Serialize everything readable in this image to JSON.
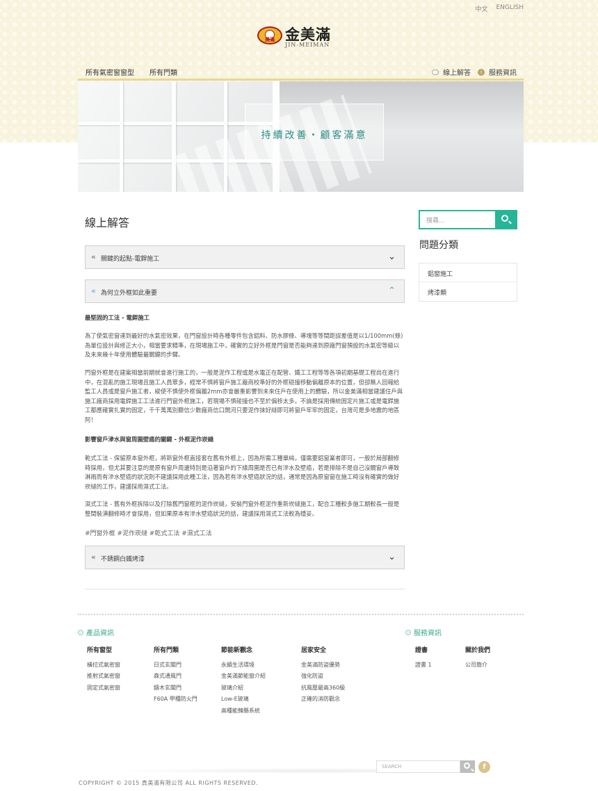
{
  "lang": {
    "zh": "中文",
    "en": "ENGLISH"
  },
  "logo": {
    "cn": "金美滿",
    "en": "JIN-MEIMAN",
    "badge": "美滿"
  },
  "nav": {
    "left": [
      "所有氣密窗窗型",
      "所有門類"
    ],
    "faq": "線上解答",
    "service": "服務資訊"
  },
  "hero": {
    "slogan": "持續改善・顧客滿意"
  },
  "main": {
    "title": "線上解答",
    "accordion": [
      {
        "label": "關鍵的起點-電銲施工",
        "open": false
      },
      {
        "label": "為何立外框如此重要",
        "open": true
      },
      {
        "label": "不銹鋼白鐵烤漆",
        "open": false
      }
    ],
    "article": {
      "h1": "最堅固的工法 - 電銲施工",
      "p1": "為了使氣密窗達到最好的水氣密效果，在門窗設計時各種零件包含鋁料、防水膠條、導塊等等間距誤差值是以1/100mm(條)為單位設計與修正大小，相當要求精準，在現場施工中，確實的立好外框是門窗是否能夠達到原廠門窗預設的水氣密等級以及未來幾十年使用體驗最關鍵的步驟。",
      "p2": "門窗外框是在建案相當前期就會進行施工的，一般是泥作工程或是水電正在配管、鐵工工程等等各項初期基礎工程尚在進行中，在混亂的施工現場且施工人員眾多，經常不慎將窗戶施工廠商校準好的外框碰撞移動偏離原本的位置，但卻無人回報給監工人員或是窗戶施工者，縱使不慎使外框偏離2mm亦會嚴重影響到未來住戶在使用上的體驗，所以金美滿相當建議住戶與施工廠商採用電銲施工工法進行門窗外框施工，若現場不慎碰撞也不至於偏移太多，不論是採用傳統固定片施工或是電銲施工都應確實扎實的固定，千千萬萬別聽信少數廠商信口開河只要泥作抹好縫即可將窗戶牢牢的固定，台灣可是多地震的地區阿！",
      "h2": "影響窗戶滲水與窗周圍壁癌的關鍵 - 外框泥作崁縫",
      "p3": "乾式工法 - 保留原本窗外框，將新窗外框直接套在舊有外框上，因為所需工種單純，僅需要鋁窗業者即可，一般於局部翻修時採用，但尤其要注意的是原有窗戶周邊特別是沿著窗戶的下緣周圍是否已有滲水及壁癌，若是排除不是自己沒關窗戶導致淋雨而有滲水壁癌的狀況則不建議採用此種工法，因為若有滲水壁癌狀況的話，通常是因為原窗窗在施工時沒有確實的做好崁縫的工作，建議採用濕式工法。",
      "p4": "濕式工法 - 舊有外框拆除以及打除舊門窗框的泥作崁縫，安裝門窗外框泥作重新崁縫施工，配合工種較多施工期較長一般是整間裝潢翻修時才會採用，但如果原本有滲水壁癌狀況的話，建議採用濕式工法較為穩妥。",
      "tags": "#門窗外框 #泥作崁縫 #乾式工法 #濕式工法"
    }
  },
  "sidebar": {
    "search_placeholder": "搜尋...",
    "title": "問題分類",
    "items": [
      "鋁窗施工",
      "烤漆類"
    ]
  },
  "footer": {
    "head_product": "產品資訊",
    "head_service": "服務資訊",
    "cols": [
      {
        "h": "所有窗型",
        "items": [
          "橫拉式氣密窗",
          "推射式氣密窗",
          "固定式氣密窗"
        ]
      },
      {
        "h": "所有門類",
        "items": [
          "日式玄關門",
          "森式通風門",
          "鑄木玄關門",
          "F60A 甲種防火門"
        ]
      },
      {
        "h": "節能新觀念",
        "items": [
          "永續生活環境",
          "金美滿節能窗介紹",
          "玻璃介紹",
          "Low-E玻璃",
          "高種能韓縣系統"
        ]
      },
      {
        "h": "居家安全",
        "items": [
          "金美滿防盜優勢",
          "強化防盜",
          "抗風壓最高360級",
          "正確的消防觀念"
        ]
      },
      {
        "h": "證書",
        "items": [
          "證書 1"
        ]
      },
      {
        "h": "關於我們",
        "items": [
          "公司簡介"
        ]
      }
    ],
    "search_placeholder": "SEARCH",
    "fb": "f",
    "copyright": "COPYRIGHT © 2015 真美滿有限公司 ALL RIGHTS RESERVED."
  },
  "colors": {
    "accent": "#26b597",
    "gold": "#e8d890",
    "link_blue": "#4ba3c7"
  }
}
